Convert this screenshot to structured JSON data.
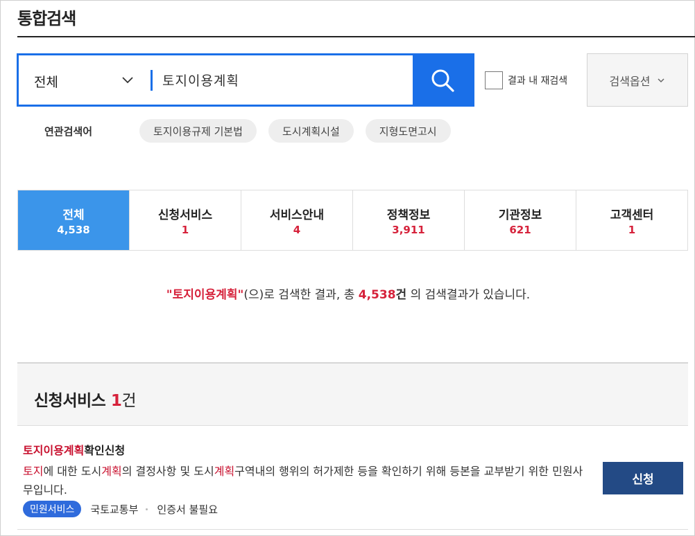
{
  "page": {
    "title": "통합검색"
  },
  "search": {
    "scope_label": "전체",
    "query": "토지이용계획",
    "re_search_label": "결과 내 재검색",
    "options_label": "검색옵션"
  },
  "related": {
    "label": "연관검색어",
    "terms": [
      "토지이용규제 기본법",
      "도시계획시설",
      "지형도면고시"
    ]
  },
  "tabs": [
    {
      "name": "전체",
      "count": "4,538",
      "active": true
    },
    {
      "name": "신청서비스",
      "count": "1"
    },
    {
      "name": "서비스안내",
      "count": "4"
    },
    {
      "name": "정책정보",
      "count": "3,911"
    },
    {
      "name": "기관정보",
      "count": "621"
    },
    {
      "name": "고객센터",
      "count": "1"
    }
  ],
  "summary": {
    "quote_open": "\"",
    "keyword": "토지이용계획",
    "quote_close": "\"",
    "text1": "(으)로 검색한 결과, 총 ",
    "total": "4,538",
    "unit": "건",
    "text2": " 의 검색결과가 있습니다."
  },
  "section": {
    "title": "신청서비스 ",
    "count": "1",
    "unit": "건"
  },
  "result": {
    "title_hl": "토지이용계획",
    "title_rest": "확인신청",
    "desc": {
      "p1": "토지",
      "p2": "에 대한 도시",
      "p3": "계획",
      "p4": "의 결정사항 및 도시",
      "p5": "계획",
      "p6": "구역내의 행위의 허가제한 등을 확인하기 위해 등본을 교부받기 위한 민원사무입니다."
    },
    "badge": "민원서비스",
    "org": "국토교통부",
    "cert": "인증서 불필요",
    "apply_label": "신청"
  },
  "colors": {
    "accent": "#1a6fe8",
    "active_tab": "#3b95ea",
    "highlight": "#d6223b",
    "apply": "#234a85"
  }
}
